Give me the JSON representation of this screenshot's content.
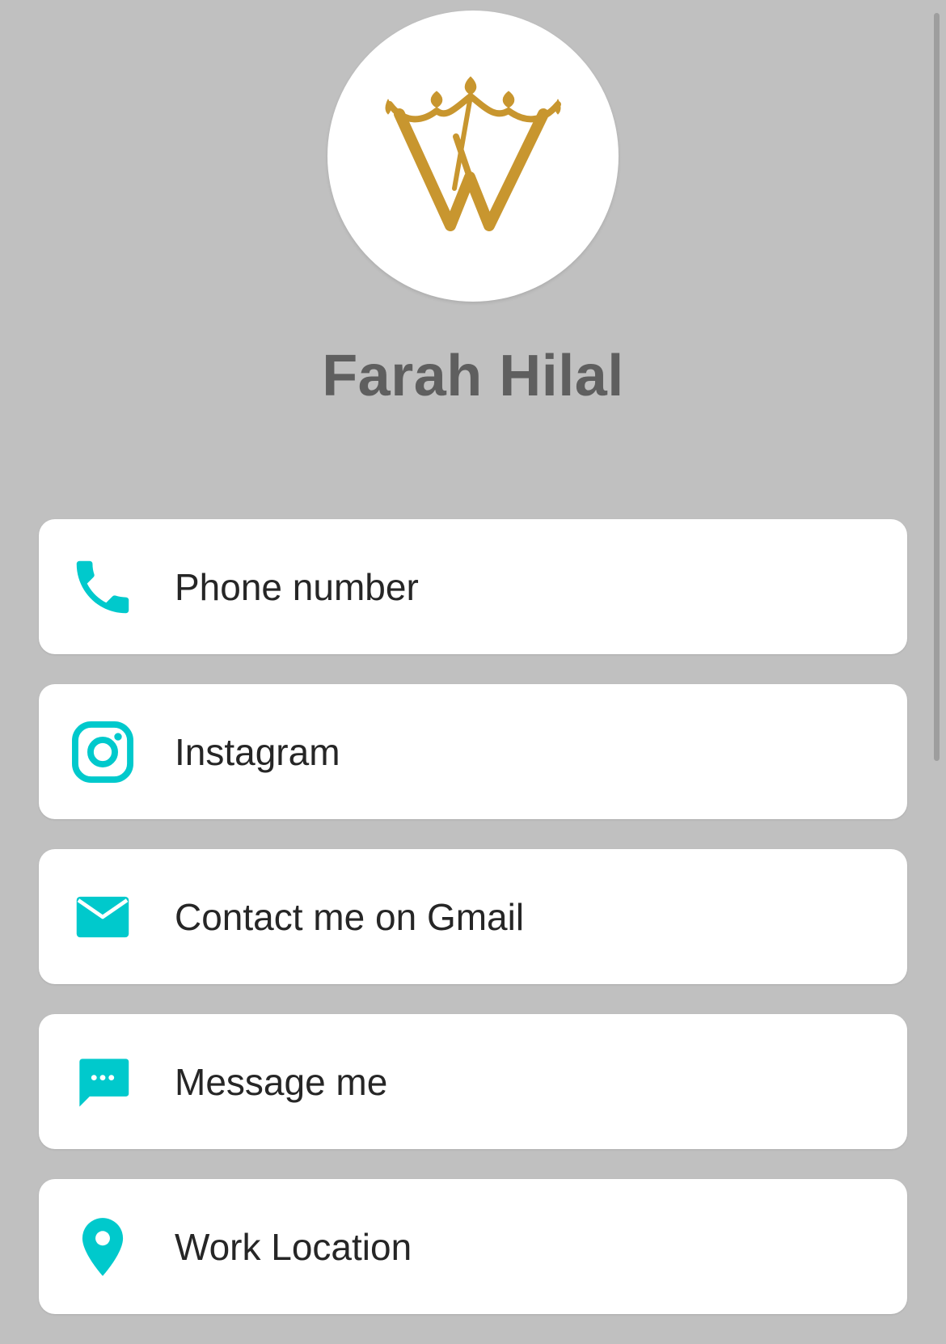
{
  "profile": {
    "name": "Farah Hilal",
    "logo_icon": "crown-w-logo",
    "logo_color": "#c8962f"
  },
  "theme": {
    "background": "#c0c0c0",
    "accent": "#00c9cc",
    "card_background": "#ffffff"
  },
  "links": [
    {
      "label": "Phone number",
      "icon": "phone-icon"
    },
    {
      "label": "Instagram",
      "icon": "instagram-icon"
    },
    {
      "label": "Contact me on Gmail",
      "icon": "mail-icon"
    },
    {
      "label": "Message me",
      "icon": "message-icon"
    },
    {
      "label": "Work Location",
      "icon": "location-pin-icon"
    }
  ]
}
